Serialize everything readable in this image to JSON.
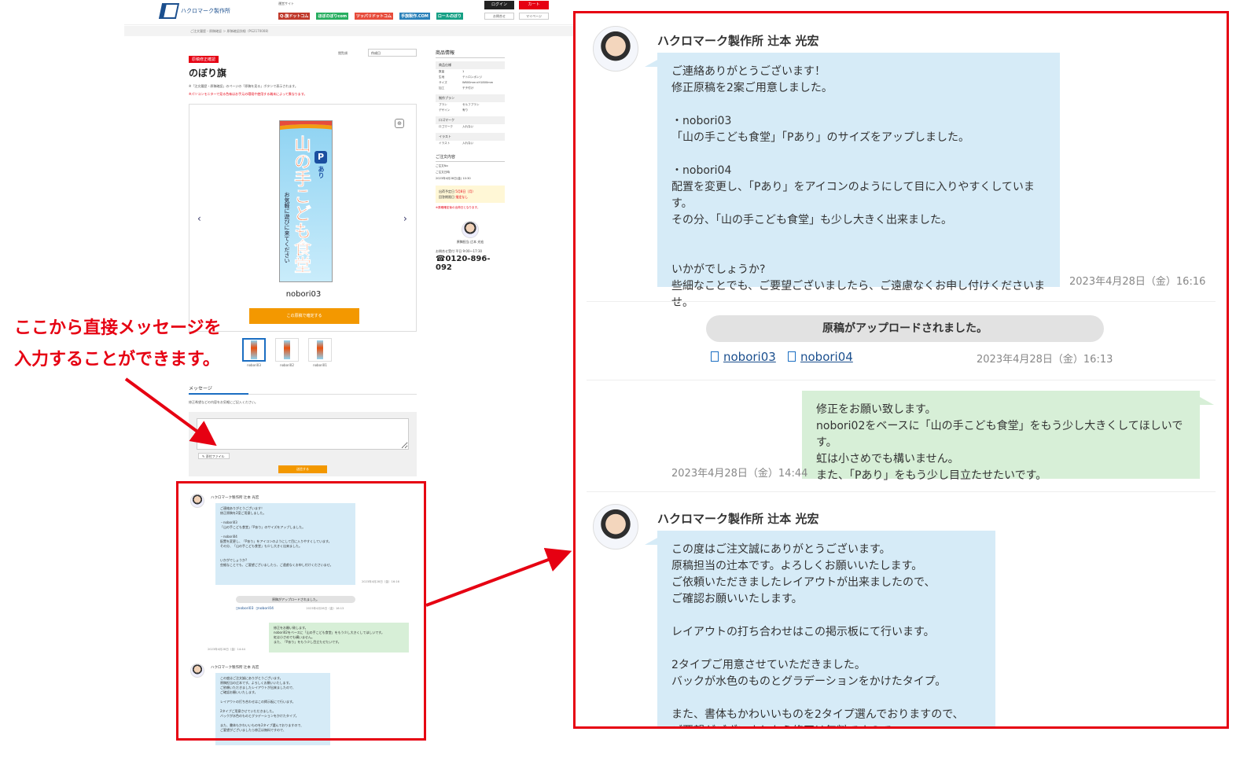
{
  "header": {
    "logo_text": "ハクロマーク製作所",
    "ops_label": "運営サイト",
    "ops_sites": [
      "Q-旗ドットコム",
      "ほぼのぼりcom",
      "ツッパリドットコム",
      "手旗製作.COM",
      "ロールのぼり"
    ],
    "login_label": "ログイン",
    "cart_label": "カート",
    "sub_links": [
      "お問合せ",
      "マイページ"
    ]
  },
  "breadcrumb": "ご注文履歴・原稿確認 ＞ 原稿確認詳細（PG2170008）",
  "main": {
    "status_badge": "原稿修正確認",
    "sort_label": "閲覧順",
    "sort_value": "作成日",
    "title": "のぼり旗",
    "note": "※「注文履歴・原稿確認」のページの「原稿を見る」ボタンで表示されます。",
    "note_red": "※パソコンモニターで見る色味はお手元の環境や使用する端末によって異なります。",
    "banner_main": "山の手こども食堂",
    "banner_sub": "お気軽に遊びに来てください",
    "banner_p": "P",
    "banner_ari": "あり",
    "preview_name": "nobori03",
    "confirm_label": "この原稿で確定する",
    "thumbs": [
      {
        "label": "nobori03"
      },
      {
        "label": "nobori02"
      },
      {
        "label": "nobori01"
      }
    ],
    "msg_tab": "メッセージ",
    "msg_hint": "修正希望などの内容をお気軽にご記入ください。",
    "attach_label": "添付ファイル",
    "send_label": "送信する"
  },
  "sidebar": {
    "title": "商品情報",
    "sections": [
      {
        "heading": "商品仕様",
        "rows": [
          [
            "数量",
            "1"
          ],
          [
            "生地",
            "テトロンポンジ"
          ],
          [
            "サイズ",
            "W600mm×H1800mm"
          ],
          [
            "加工",
            "チチ付け"
          ]
        ]
      },
      {
        "heading": "制作プラン",
        "rows": [
          [
            "プラン",
            "セルフプラン"
          ],
          [
            "デザイン",
            "有り"
          ]
        ]
      },
      {
        "heading": "ロゴマーク",
        "rows": [
          [
            "ロゴマーク",
            "入れない"
          ]
        ]
      },
      {
        "heading": "イラスト",
        "rows": [
          [
            "イラスト",
            "入れない"
          ]
        ]
      }
    ],
    "order_title": "ご注文内容",
    "order_no_label": "ご注文No",
    "order_date_label": "ご注文日時",
    "order_date": "2023年4月28日(金) 10:30",
    "ship_label": "出荷予定日",
    "ship_value": "5月8日（月）",
    "deadline_label": "回答期限日",
    "deadline_value": "指定なし",
    "warn": "※原稿確定後の出荷日となります。",
    "staff_name": "原稿担当 辻本 光宏",
    "hours": "お問合せ受付 平日 9:00〜17:30",
    "phone": "0120-896-092"
  },
  "callout": {
    "line1": "ここから直接メッセージを",
    "line2": "入力することができます。"
  },
  "thread": {
    "sender": "ハクロマーク製作所 辻本 光宏",
    "msg1": {
      "text": "ご連絡ありがとうございます！\n修正原稿を2案ご用意しました。\n\n・nobori03\n「山の手こども食堂」「Pあり」のサイズをアップしました。\n\n・nobori04\n配置を変更し、「Pあり」をアイコンのようにして目に入りやすくしています。\nその分、「山の手こども食堂」も少し大きく出来ました。\n\n\nいかがでしょうか?\n些細なことでも、ご要望ございましたら、ご遠慮なくお申し付けくださいませ。",
      "time": "2023年4月28日（金）16:16"
    },
    "system": {
      "text": "原稿がアップロードされました。",
      "files": [
        "nobori03",
        "nobori04"
      ],
      "time": "2023年4月28日（金）16:13"
    },
    "msg2": {
      "text": "修正をお願い致します。\nnobori02をベースに「山の手こども食堂」をもう少し大きくしてほしいです。\n虹は小さめでも構いません。\nまた、「Pあり」をもう少し目立たせたいです。",
      "time": "2023年4月28日（金）14:44"
    },
    "msg3": {
      "text": "この度はご注文誠にありがとうございます。\n原稿担当の辻本です。よろしくお願いいたします。\nご依頼いただきましたレイアウトが出来ましたので、\nご確認お願いいたします。\n\nレイアウトの打ち合わせはこの掲示板にて行います。\n\n2タイプご用意させていただきました。\nバックが水色のものとグラデーションをかけたタイプ。\n\nまた、書体もかわいいものを2タイプ選んでおりますので、\nご要望がございましたら修正は無料ですので、"
    }
  },
  "colors": {
    "accent_red": "#e60012",
    "accent_orange": "#f39800",
    "bubble_blue": "#d6ebf7",
    "bubble_green": "#d7efd7"
  }
}
